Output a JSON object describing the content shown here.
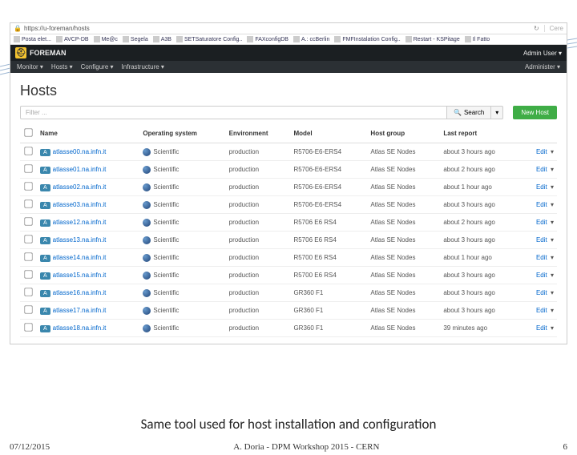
{
  "browser": {
    "url": "https://u-foreman/hosts",
    "search_placeholder": "Cere",
    "bookmarks": [
      "Posta elet...",
      "AVCP-DB",
      "Me@c",
      "Segela",
      "A3B",
      "SETSaturatore Config..",
      "FAXconfigDB",
      "A.: ccBerlin",
      "FMFInstalation Config..",
      "Restart - KSPitage",
      "Il Fatto"
    ]
  },
  "brand": "FOREMAN",
  "top_admin": "Admin User",
  "nav": {
    "items": [
      "Monitor",
      "Hosts",
      "Configure",
      "Infrastructure"
    ],
    "right": "Administer"
  },
  "page_title": "Hosts",
  "filter_placeholder": "Filter ...",
  "search_label": "Search",
  "new_host_label": "New Host",
  "headers": [
    "Name",
    "Operating system",
    "Environment",
    "Model",
    "Host group",
    "Last report",
    ""
  ],
  "edit_label": "Edit",
  "badge": "A",
  "rows": [
    {
      "name": "atlasse00.na.infn.it",
      "os": "Scientific",
      "env": "production",
      "model": "R5706-E6-ERS4",
      "group": "Atlas SE Nodes",
      "report": "about 3 hours ago"
    },
    {
      "name": "atlasse01.na.infn.it",
      "os": "Scientific",
      "env": "production",
      "model": "R5706-E6-ERS4",
      "group": "Atlas SE Nodes",
      "report": "about 2 hours ago"
    },
    {
      "name": "atlasse02.na.infn.it",
      "os": "Scientific",
      "env": "production",
      "model": "R5706-E6-ERS4",
      "group": "Atlas SE Nodes",
      "report": "about 1 hour ago"
    },
    {
      "name": "atlasse03.na.infn.it",
      "os": "Scientific",
      "env": "production",
      "model": "R5706-E6-ERS4",
      "group": "Atlas SE Nodes",
      "report": "about 3 hours ago"
    },
    {
      "name": "atlasse12.na.infn.it",
      "os": "Scientific",
      "env": "production",
      "model": "R5706 E6 RS4",
      "group": "Atlas SE Nodes",
      "report": "about 2 hours ago"
    },
    {
      "name": "atlasse13.na.infn.it",
      "os": "Scientific",
      "env": "production",
      "model": "R5706 E6 RS4",
      "group": "Atlas SE Nodes",
      "report": "about 3 hours ago"
    },
    {
      "name": "atlasse14.na.infn.it",
      "os": "Scientific",
      "env": "production",
      "model": "R5700 E6 RS4",
      "group": "Atlas SE Nodes",
      "report": "about 1 hour ago"
    },
    {
      "name": "atlasse15.na.infn.it",
      "os": "Scientific",
      "env": "production",
      "model": "R5700 E6 RS4",
      "group": "Atlas SE Nodes",
      "report": "about 3 hours ago"
    },
    {
      "name": "atlasse16.na.infn.it",
      "os": "Scientific",
      "env": "production",
      "model": "GR360 F1",
      "group": "Atlas SE Nodes",
      "report": "about 3 hours ago"
    },
    {
      "name": "atlasse17.na.infn.it",
      "os": "Scientific",
      "env": "production",
      "model": "GR360 F1",
      "group": "Atlas SE Nodes",
      "report": "about 3 hours ago"
    },
    {
      "name": "atlasse18.na.infn.it",
      "os": "Scientific",
      "env": "production",
      "model": "GR360 F1",
      "group": "Atlas SE Nodes",
      "report": "39 minutes ago"
    }
  ],
  "caption": "Same tool used for host installation and configuration",
  "footer": {
    "date": "07/12/2015",
    "center": "A. Doria - DPM Workshop 2015 - CERN",
    "page": "6"
  }
}
